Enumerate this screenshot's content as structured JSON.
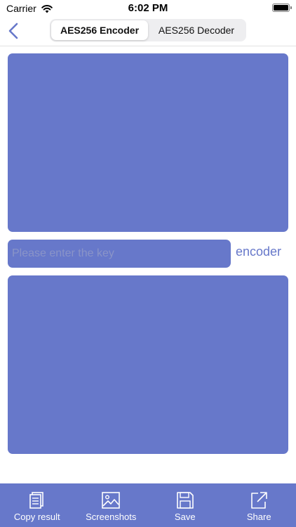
{
  "status_bar": {
    "carrier": "Carrier",
    "time": "6:02 PM"
  },
  "nav": {
    "segments": [
      {
        "label": "AES256 Encoder",
        "selected": true
      },
      {
        "label": "AES256 Decoder",
        "selected": false
      }
    ]
  },
  "input_area": {
    "value": ""
  },
  "key_field": {
    "placeholder": "Please enter the key",
    "value": ""
  },
  "encoder_button": {
    "label": "encoder"
  },
  "output_area": {
    "value": ""
  },
  "toolbar": {
    "items": [
      {
        "label": "Copy result",
        "icon": "copy-icon"
      },
      {
        "label": "Screenshots",
        "icon": "image-icon"
      },
      {
        "label": "Save",
        "icon": "save-icon"
      },
      {
        "label": "Share",
        "icon": "share-icon"
      }
    ]
  },
  "colors": {
    "accent": "#6778ca",
    "background": "#ffffff"
  }
}
